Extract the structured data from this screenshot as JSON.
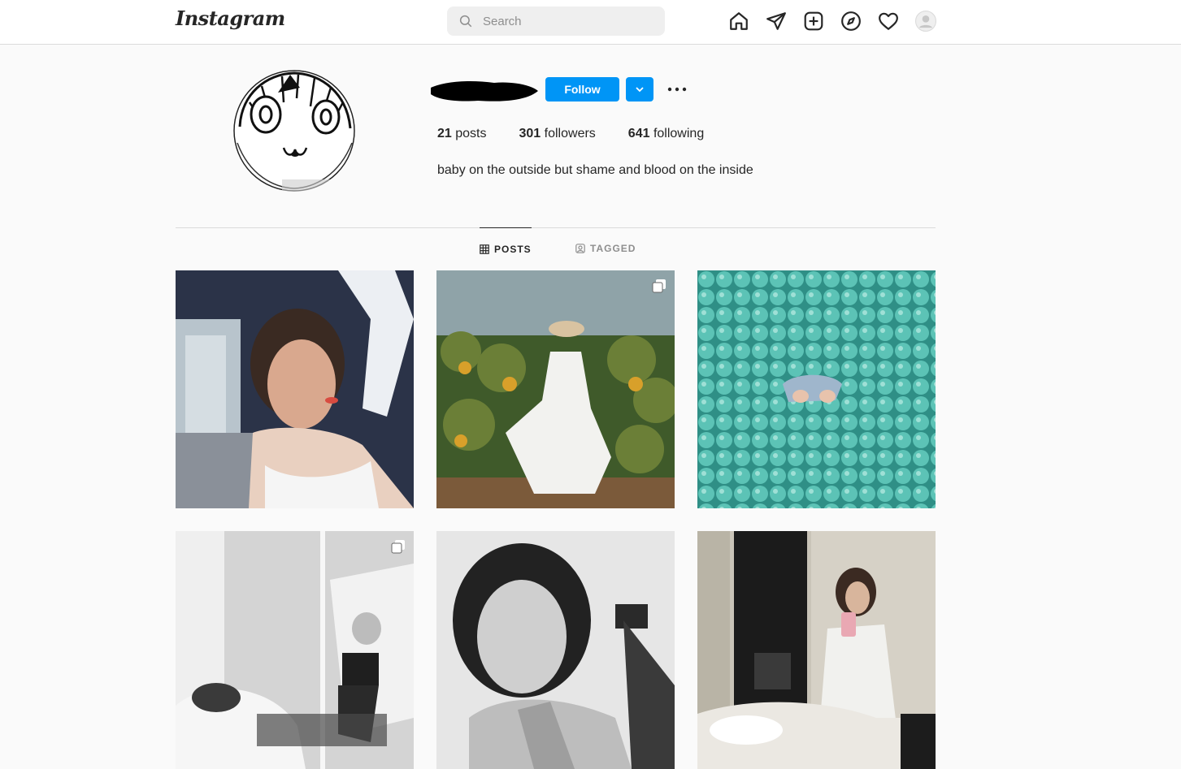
{
  "nav": {
    "logo_text": "Instagram",
    "search_placeholder": "Search",
    "icons": [
      "home-icon",
      "direct-icon",
      "new-post-icon",
      "explore-icon",
      "activity-icon",
      "profile-avatar-icon"
    ]
  },
  "profile": {
    "follow_label": "Follow",
    "stats": {
      "posts_count": "21",
      "posts_label": "posts",
      "followers_count": "301",
      "followers_label": "followers",
      "following_count": "641",
      "following_label": "following"
    },
    "bio": "baby on the outside but shame and blood on the inside"
  },
  "tabs": [
    {
      "label": "POSTS",
      "active": true
    },
    {
      "label": "TAGGED",
      "active": false
    }
  ],
  "colors": {
    "accent": "#0095f6",
    "text": "#262626",
    "muted": "#8e8e8e",
    "border": "#dbdbdb",
    "background": "#fafafa"
  }
}
